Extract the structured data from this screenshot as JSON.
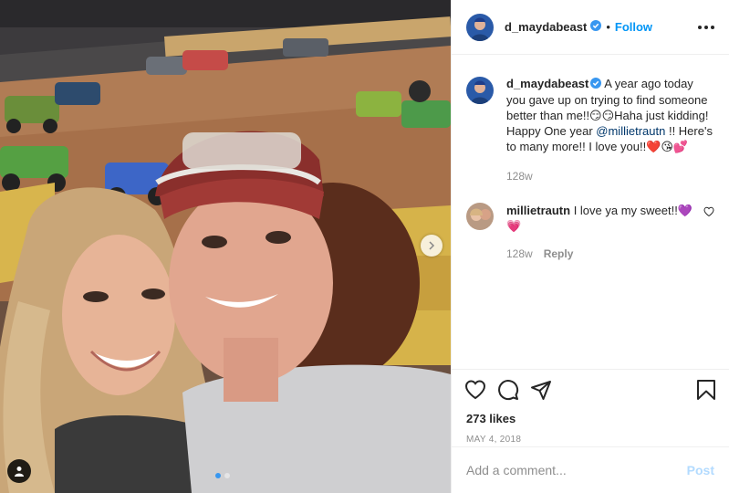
{
  "post": {
    "author": "d_maydabeast",
    "follow_label": "Follow",
    "separator": "•",
    "caption_text": " A year ago today you gave up on trying to find someone better than me!!😏😏Haha just kidding! Happy One year ",
    "caption_mention": "@millietrautn",
    "caption_end": " !! Here's to many more!! I love you!!❤️😘💕",
    "caption_age": "128w",
    "likes": "273 likes",
    "date": "MAY 4, 2018"
  },
  "comments": [
    {
      "username": "millietrautn",
      "text": " I love ya my sweet!!💜💗",
      "age": "128w",
      "reply_label": "Reply"
    }
  ],
  "composer": {
    "placeholder": "Add a comment...",
    "post_label": "Post"
  },
  "colors": {
    "accent": "#0095f6",
    "verified": "#3897f0",
    "post_disabled": "#b3dbff"
  }
}
